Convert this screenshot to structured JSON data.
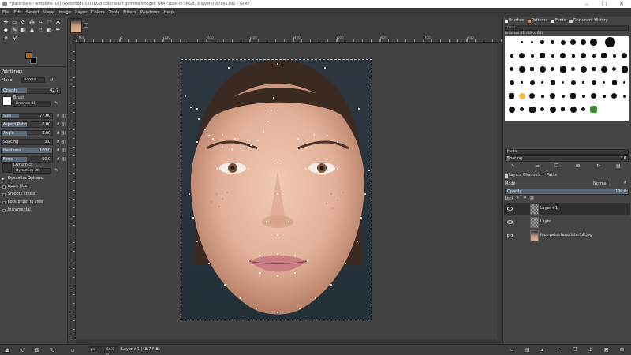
{
  "window": {
    "title": "*[face-paint-template-full] (exported)-1.0 (RGB color 8-bit gamma integer, GIMP built-in sRGB, 3 layers) 878x1192 – GIMP",
    "minimize": "–",
    "maximize": "□",
    "close": "✕"
  },
  "menu": [
    "File",
    "Edit",
    "Select",
    "View",
    "Image",
    "Layer",
    "Colors",
    "Tools",
    "Filters",
    "Windows",
    "Help"
  ],
  "toolbox": {
    "fg_color": "#b0651c",
    "bg_color": "#000000",
    "tool_options_title": "Paintbrush",
    "mode_label": "Mode",
    "mode_value": "Normal",
    "opacity_label": "Opacity",
    "opacity_value": "42.7",
    "brush_label": "Brush",
    "brush_name": "Brushes 01",
    "sliders": [
      {
        "label": "Size",
        "value": "77.00",
        "fraction": 0.35
      },
      {
        "label": "Aspect Ratio",
        "value": "0.00",
        "fraction": 0.5
      },
      {
        "label": "Angle",
        "value": "0.00",
        "fraction": 0.5
      },
      {
        "label": "Spacing",
        "value": "3.0",
        "fraction": 0.03
      },
      {
        "label": "Hardness",
        "value": "100.0",
        "fraction": 1.0
      },
      {
        "label": "Force",
        "value": "50.0",
        "fraction": 0.5
      }
    ],
    "dynamics_label": "Dynamics",
    "dynamics_value": "Dynamics Off",
    "options": [
      "Dynamics Options",
      "Apply Jitter",
      "Smooth stroke",
      "Lock brush to view",
      "Incremental"
    ]
  },
  "ruler_marks": [
    "-100",
    "0",
    "100",
    "200",
    "300",
    "400",
    "500",
    "600",
    "700",
    "800"
  ],
  "status": {
    "unit": "px",
    "zoom": "66.7 %",
    "layer_info": "Layer #1 (48.7 MB)"
  },
  "dock": {
    "tabs": [
      "Brushes",
      "Patterns",
      "Fonts",
      "Document History"
    ],
    "filter_placeholder": "filter",
    "brush_title": "Brushes 01 (64 × 64)",
    "media_label": "Media",
    "spacing_label": "Spacing",
    "spacing_value": "3.0",
    "layers_tabs": [
      "Layers",
      "Channels",
      "Paths"
    ],
    "mode_label": "Mode",
    "mode_value": "Normal",
    "opacity_label": "Opacity",
    "opacity_value": "100.0",
    "lock_label": "Lock",
    "layers": [
      {
        "name": "Layer #1",
        "selected": true
      },
      {
        "name": "Layer",
        "selected": false
      },
      {
        "name": "face-paint-template-full.jpg",
        "selected": false
      }
    ]
  }
}
